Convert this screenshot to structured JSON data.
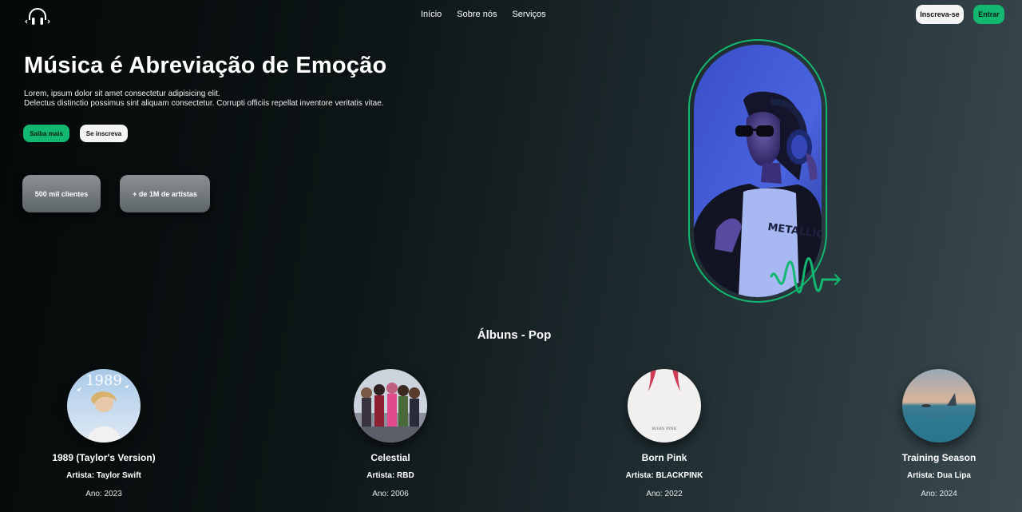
{
  "nav": {
    "items": [
      "Início",
      "Sobre nós",
      "Serviços"
    ],
    "signup_label": "Inscreva-se",
    "login_label": "Entrar"
  },
  "hero": {
    "title": "Música é Abreviação de Emoção",
    "desc_line1": "Lorem, ipsum dolor sit amet consectetur adipisicing elit.",
    "desc_line2": "Delectus distinctio possimus sint aliquam consectetur. Corrupti officiis repellat inventore veritatis vitae.",
    "more_label": "Saiba mais",
    "subscribe_label": "Se inscreva",
    "stats": [
      "500 mil clientes",
      "+ de 1M de artistas"
    ]
  },
  "albums": {
    "title": "Álbuns - Pop",
    "items": [
      {
        "name": "1989 (Taylor's Version)",
        "artist": "Artista: Taylor Swift",
        "year": "Ano: 2023",
        "cover_text": "1989"
      },
      {
        "name": "Celestial",
        "artist": "Artista: RBD",
        "year": "Ano: 2006"
      },
      {
        "name": "Born Pink",
        "artist": "Artista: BLACKPINK",
        "year": "Ano: 2022",
        "cover_text": "BORN PINK"
      },
      {
        "name": "Training Season",
        "artist": "Artista: Dua Lipa",
        "year": "Ano: 2024"
      }
    ]
  },
  "colors": {
    "accent": "#12b870",
    "light_button": "#f4f4f4"
  },
  "icons": {
    "logo": "headphones-icon"
  }
}
